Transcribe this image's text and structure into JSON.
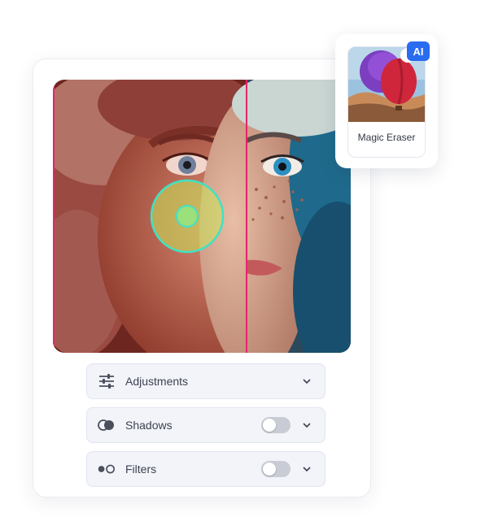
{
  "editor": {
    "panels": [
      {
        "label": "Adjustments",
        "icon": "sliders-icon",
        "has_toggle": false
      },
      {
        "label": "Shadows",
        "icon": "shadows-icon",
        "has_toggle": true,
        "toggle_on": false
      },
      {
        "label": "Filters",
        "icon": "filters-icon",
        "has_toggle": true,
        "toggle_on": false
      }
    ]
  },
  "tool": {
    "label": "Magic Eraser",
    "badge": "AI"
  },
  "colors": {
    "divider": "#e6246b",
    "brush_ring": "#3fe2c6",
    "badge": "#2a6cf0",
    "panel_bg": "#f2f4fa"
  }
}
